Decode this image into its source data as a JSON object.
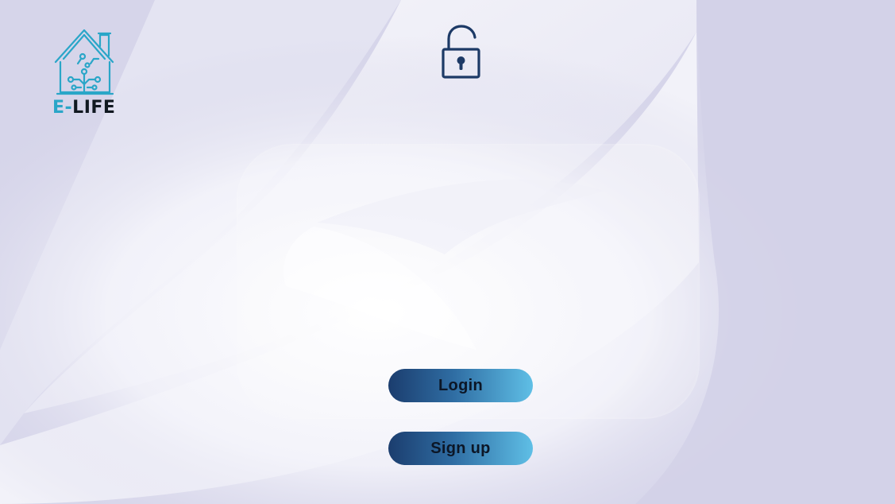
{
  "brand": {
    "prefix": "E-",
    "suffix": "LIFE",
    "icon": "smart-home-circuit-icon",
    "color_primary": "#2aa6c8",
    "color_text": "#101820"
  },
  "header": {
    "icon": "unlocked-padlock-icon",
    "icon_color": "#1d3a66"
  },
  "actions": {
    "login_label": "Login",
    "signup_label": "Sign up"
  },
  "theme": {
    "background": "#d4d3e8",
    "button_gradient_start": "#1b3d6e",
    "button_gradient_end": "#5fbfe6"
  }
}
